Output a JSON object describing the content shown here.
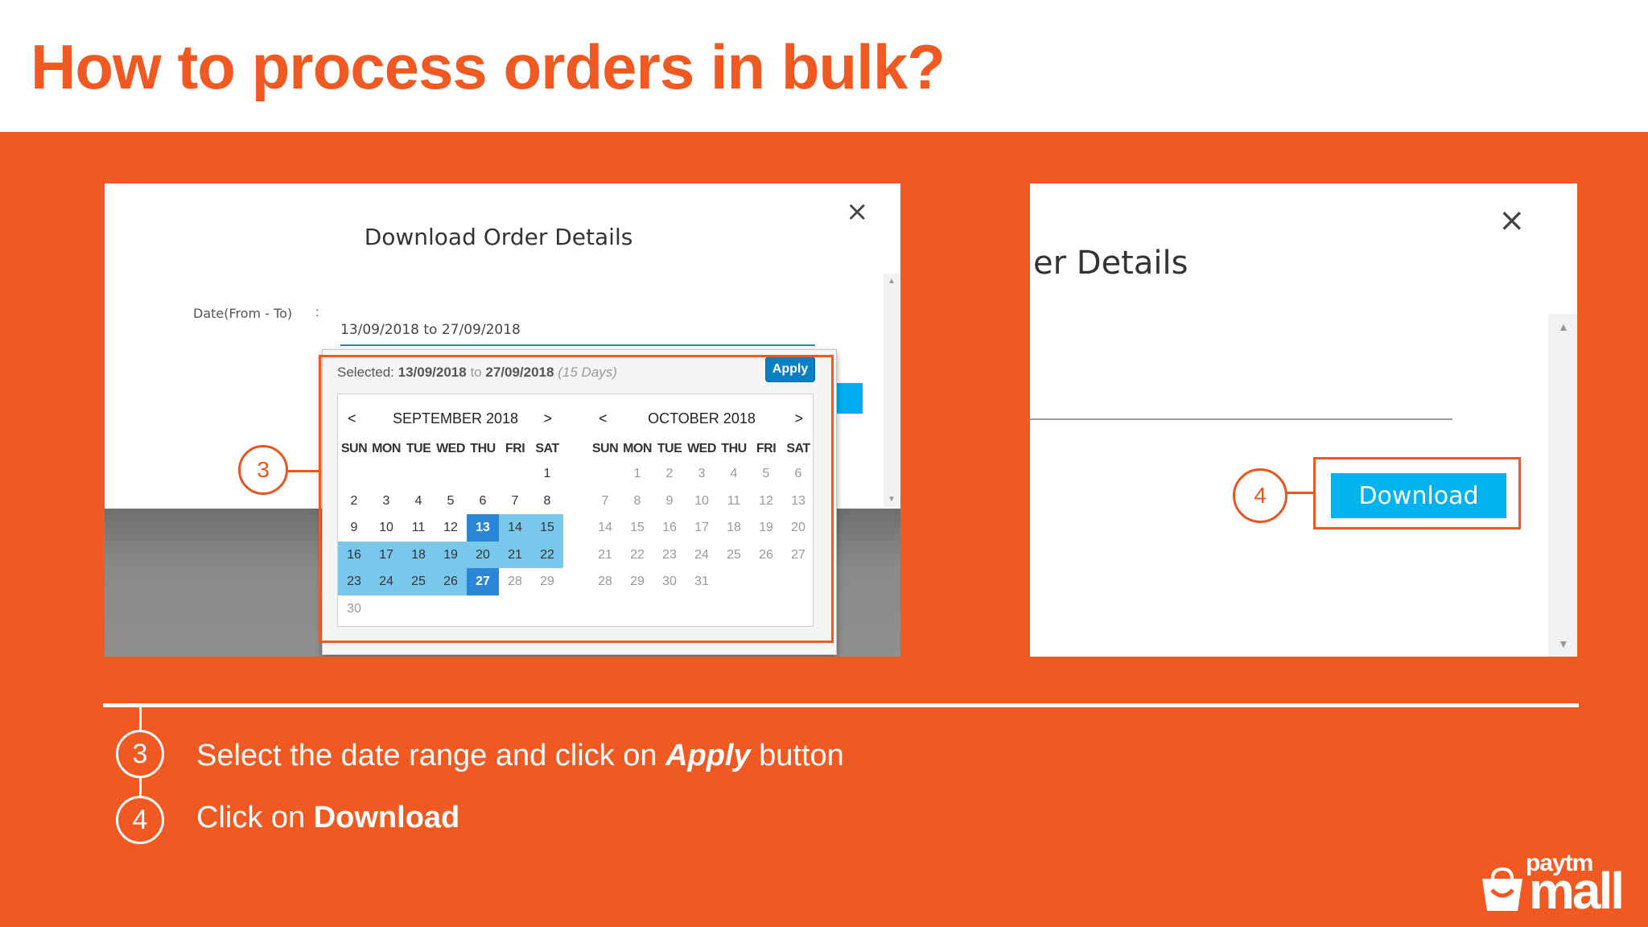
{
  "slide": {
    "title": "How to process orders in bulk?"
  },
  "left_dialog": {
    "title": "Download Order Details",
    "date_label": "Date(From - To)",
    "colon": ":",
    "date_value": "13/09/2018 to 27/09/2018",
    "picker": {
      "selected_prefix": "Selected:",
      "from": "13/09/2018",
      "to_word": "to",
      "to": "27/09/2018",
      "days": "(15 Days)",
      "apply_label": "Apply",
      "prev": "<",
      "next": ">",
      "dow": [
        "SUN",
        "MON",
        "TUE",
        "WED",
        "THU",
        "FRI",
        "SAT"
      ],
      "months": [
        {
          "name": "SEPTEMBER 2018",
          "weeks": [
            [
              "",
              "",
              "",
              "",
              "",
              "",
              "1"
            ],
            [
              "2",
              "3",
              "4",
              "5",
              "6",
              "7",
              "8"
            ],
            [
              "9",
              "10",
              "11",
              "12",
              "13",
              "14",
              "15"
            ],
            [
              "16",
              "17",
              "18",
              "19",
              "20",
              "21",
              "22"
            ],
            [
              "23",
              "24",
              "25",
              "26",
              "27",
              "28",
              "29"
            ],
            [
              "30",
              "",
              "",
              "",
              "",
              "",
              ""
            ]
          ],
          "range_start": "13",
          "range_end": "27",
          "dim_days": [
            "28",
            "29",
            "30"
          ]
        },
        {
          "name": "OCTOBER 2018",
          "weeks": [
            [
              "",
              "1",
              "2",
              "3",
              "4",
              "5",
              "6"
            ],
            [
              "7",
              "8",
              "9",
              "10",
              "11",
              "12",
              "13"
            ],
            [
              "14",
              "15",
              "16",
              "17",
              "18",
              "19",
              "20"
            ],
            [
              "21",
              "22",
              "23",
              "24",
              "25",
              "26",
              "27"
            ],
            [
              "28",
              "29",
              "30",
              "31",
              "",
              "",
              ""
            ]
          ],
          "all_dim": true
        }
      ]
    },
    "callout": "3"
  },
  "right_dialog": {
    "title_fragment": "er Details",
    "download_label": "Download",
    "callout": "4"
  },
  "close_glyph": "×",
  "steps": [
    {
      "num": "3",
      "pre": "Select the date range and click on ",
      "em": "Apply",
      "post": " button"
    },
    {
      "num": "4",
      "pre": "Click on ",
      "strong": "Download"
    }
  ],
  "logo": {
    "top": "paytm",
    "bottom": "mall"
  },
  "colors": {
    "brand_orange": "#f05a22",
    "accent_blue": "#00b3ee",
    "range_blue": "#7ac7ec",
    "endpoint_blue": "#2a87d6"
  }
}
